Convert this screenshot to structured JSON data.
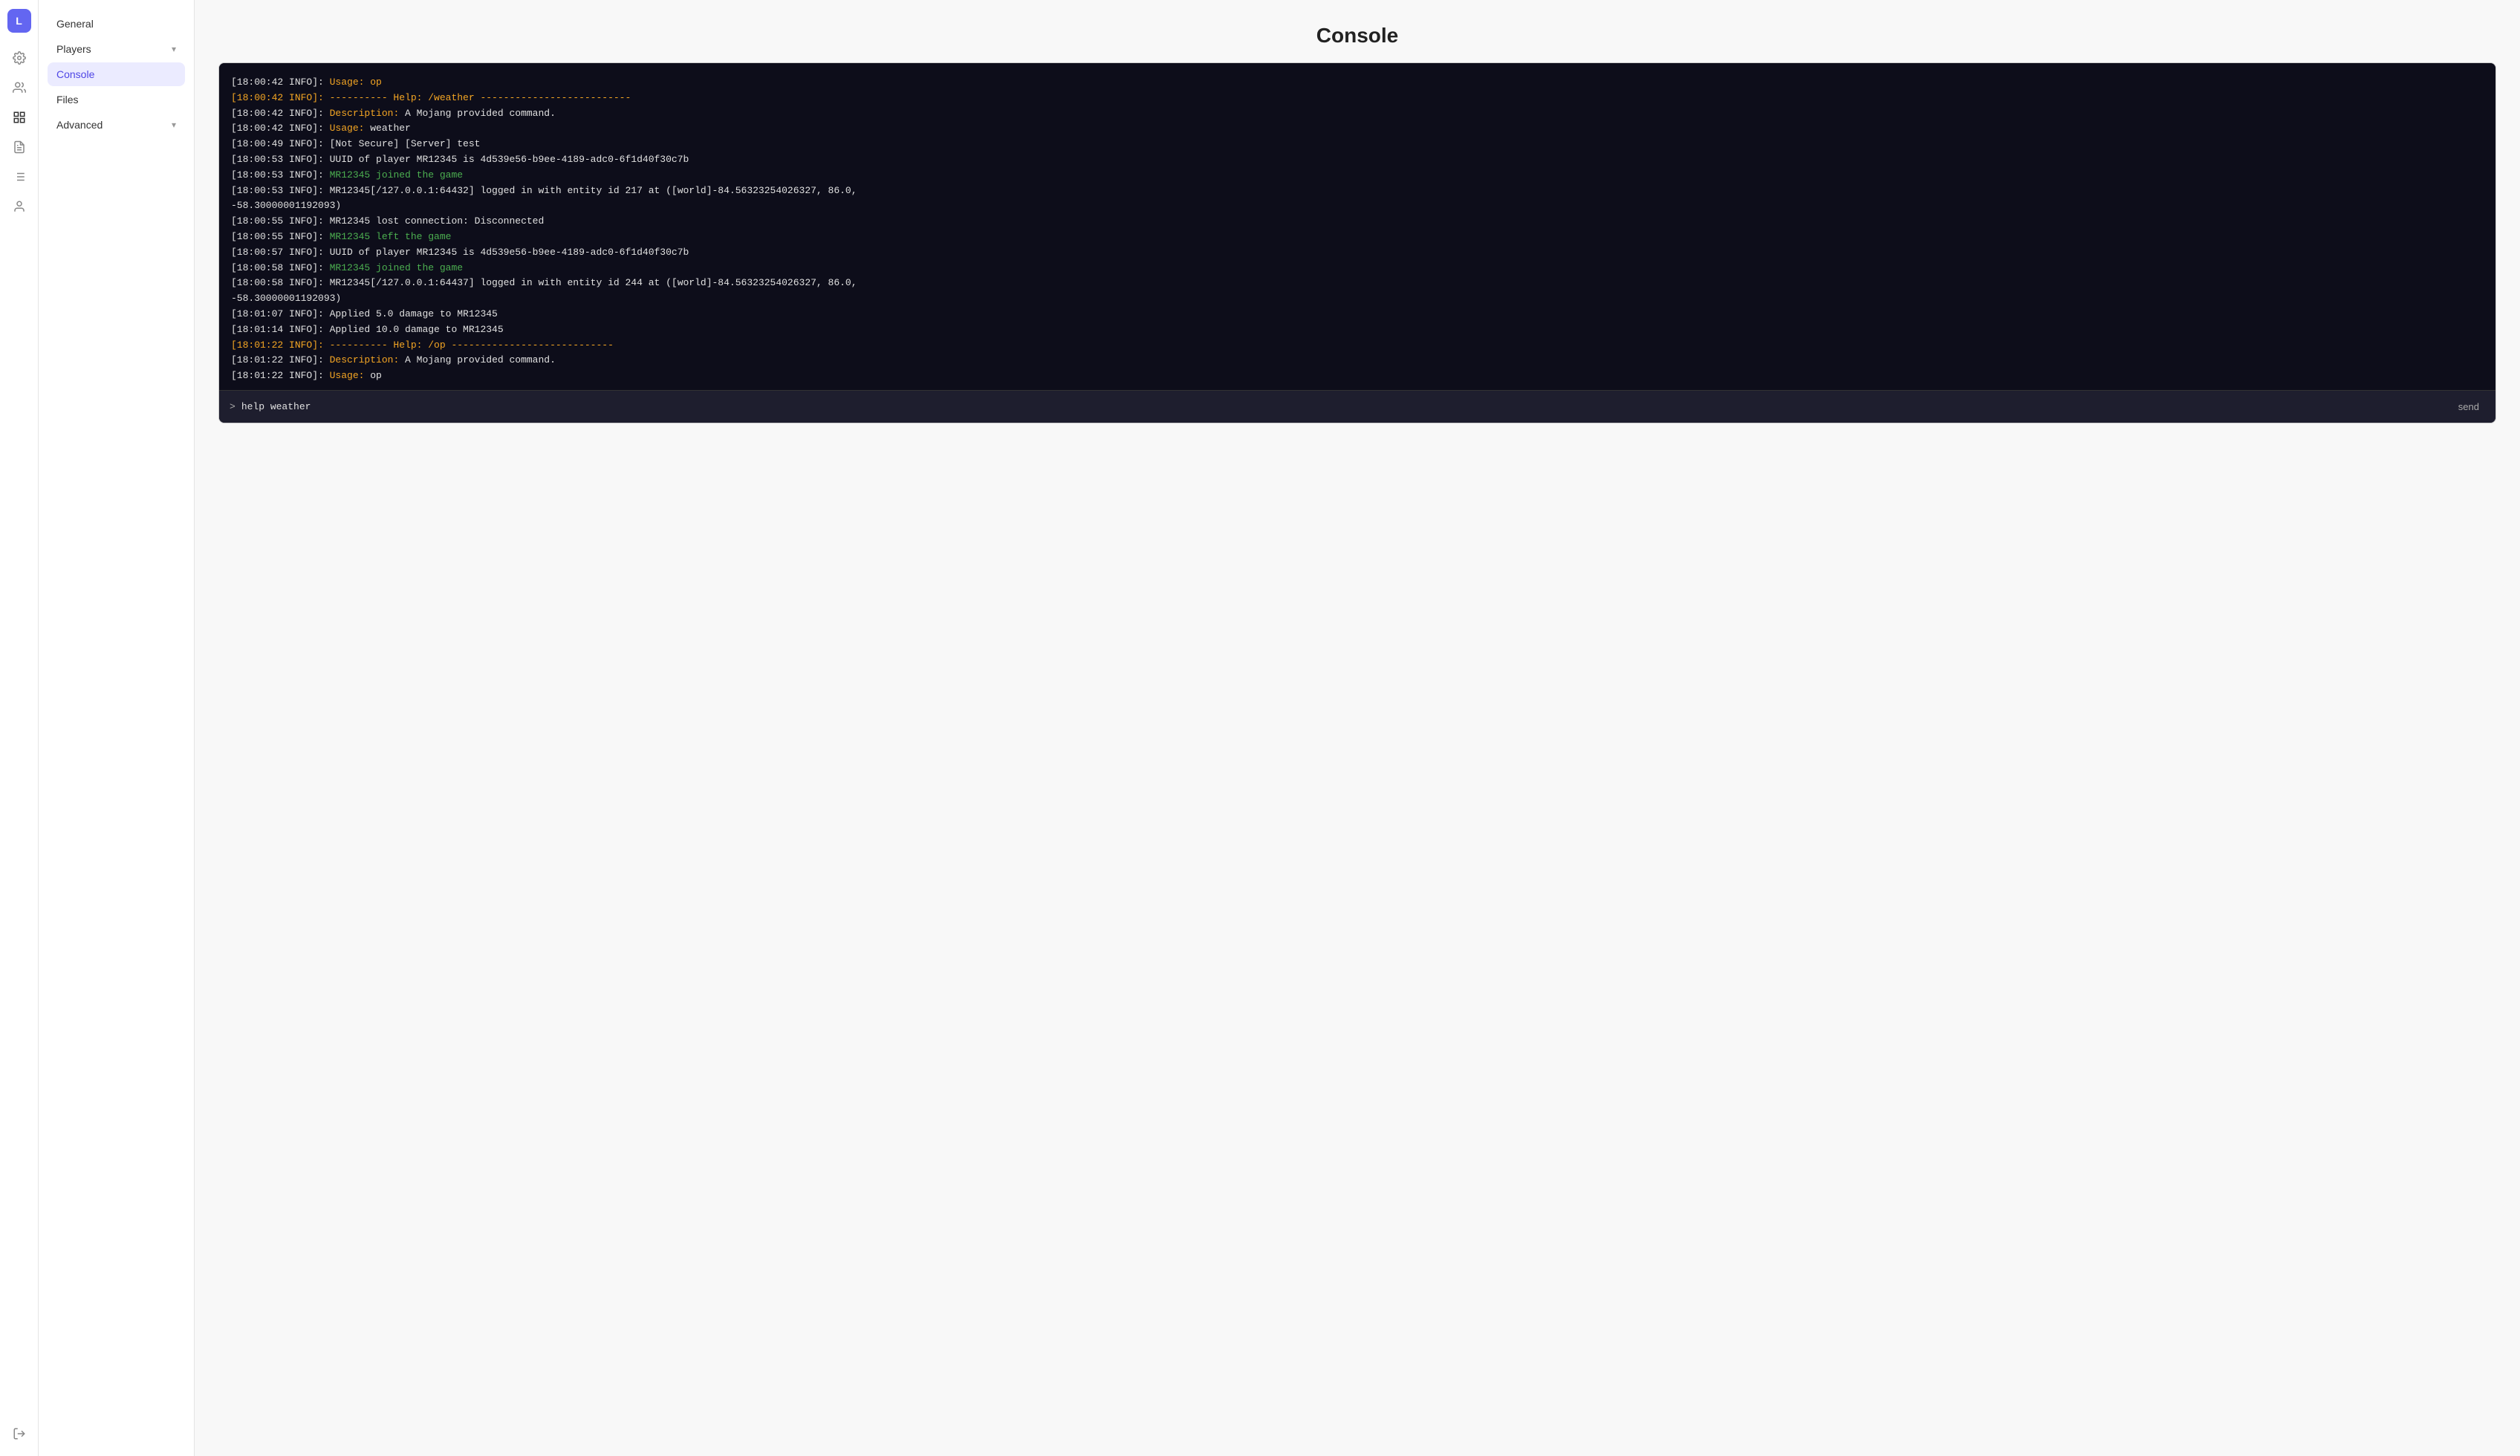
{
  "app": {
    "avatar_letter": "L",
    "page_title": "Console"
  },
  "icon_sidebar": {
    "icons": [
      {
        "name": "settings-icon",
        "symbol": "⚙",
        "active": false
      },
      {
        "name": "users-icon",
        "symbol": "👥",
        "active": false
      },
      {
        "name": "grid-icon",
        "symbol": "⊞",
        "active": false
      },
      {
        "name": "console-icon",
        "symbol": "▤",
        "active": true
      },
      {
        "name": "database-icon",
        "symbol": "⊟",
        "active": false
      },
      {
        "name": "user-icon",
        "symbol": "⊙",
        "active": false
      }
    ],
    "bottom": {
      "logout_icon": "⇥"
    }
  },
  "nav": {
    "items": [
      {
        "label": "General",
        "active": false,
        "has_chevron": false
      },
      {
        "label": "Players",
        "active": false,
        "has_chevron": true
      },
      {
        "label": "Console",
        "active": true,
        "has_chevron": false
      },
      {
        "label": "Files",
        "active": false,
        "has_chevron": false
      },
      {
        "label": "Advanced",
        "active": false,
        "has_chevron": true
      }
    ]
  },
  "console": {
    "logs": [
      {
        "text": "[18:00:42 INFO]: Usage: op",
        "type": "yellow"
      },
      {
        "text": "[18:00:42 INFO]: ---------- Help: /weather --------------------------",
        "type": "yellow"
      },
      {
        "text": "[18:00:42 INFO]: Description: A Mojang provided command.",
        "type": "normal",
        "highlight": {
          "word": "Description:",
          "color": "yellow"
        }
      },
      {
        "text": "[18:00:42 INFO]: Usage: weather",
        "type": "normal",
        "highlight": {
          "word": "Usage:",
          "color": "yellow"
        }
      },
      {
        "text": "[18:00:49 INFO]: [Not Secure] [Server] test",
        "type": "normal"
      },
      {
        "text": "[18:00:53 INFO]: UUID of player MR12345 is 4d539e56-b9ee-4189-adc0-6f1d40f30c7b",
        "type": "normal"
      },
      {
        "text": "[18:00:53 INFO]: MR12345 joined the game",
        "type": "normal",
        "highlight": {
          "word": "MR12345 joined the game",
          "color": "green"
        }
      },
      {
        "text": "[18:00:53 INFO]: MR12345[/127.0.0.1:64432] logged in with entity id 217 at ([world]-84.56323254026327, 86.0, -58.30000001192093)",
        "type": "normal"
      },
      {
        "text": "[18:00:55 INFO]: MR12345 lost connection: Disconnected",
        "type": "normal"
      },
      {
        "text": "[18:00:55 INFO]: MR12345 left the game",
        "type": "normal",
        "highlight": {
          "word": "MR12345 left the game",
          "color": "green"
        }
      },
      {
        "text": "[18:00:57 INFO]: UUID of player MR12345 is 4d539e56-b9ee-4189-adc0-6f1d40f30c7b",
        "type": "normal"
      },
      {
        "text": "[18:00:58 INFO]: MR12345 joined the game",
        "type": "normal",
        "highlight": {
          "word": "MR12345 joined the game",
          "color": "green"
        }
      },
      {
        "text": "[18:00:58 INFO]: MR12345[/127.0.0.1:64437] logged in with entity id 244 at ([world]-84.56323254026327, 86.0, -58.30000001192093)",
        "type": "normal"
      },
      {
        "text": "[18:01:07 INFO]: Applied 5.0 damage to MR12345",
        "type": "normal"
      },
      {
        "text": "[18:01:14 INFO]: Applied 10.0 damage to MR12345",
        "type": "normal"
      },
      {
        "text": "[18:01:22 INFO]: ---------- Help: /op ----------------------------",
        "type": "yellow"
      },
      {
        "text": "[18:01:22 INFO]: Description: A Mojang provided command.",
        "type": "normal",
        "highlight": {
          "word": "Description:",
          "color": "yellow"
        }
      },
      {
        "text": "[18:01:22 INFO]: Usage: op",
        "type": "normal",
        "highlight": {
          "word": "Usage:",
          "color": "yellow"
        }
      }
    ],
    "input_prompt": ">",
    "input_value": "help weather",
    "send_label": "send"
  }
}
